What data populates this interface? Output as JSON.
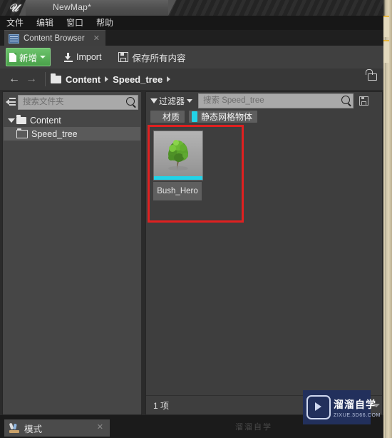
{
  "window": {
    "logo_icon": "unreal-engine-logo",
    "map_tab_title": "NewMap*"
  },
  "menubar": {
    "items": [
      {
        "label": "文件"
      },
      {
        "label": "编辑"
      },
      {
        "label": "窗口"
      },
      {
        "label": "帮助"
      }
    ]
  },
  "content_browser": {
    "tab": {
      "icon": "content-browser-icon",
      "label": "Content Browser",
      "close_label": "✕"
    },
    "toolbar": {
      "new_label": "新增",
      "import_label": "Import",
      "save_all_label": "保存所有内容"
    },
    "breadcrumb": {
      "back_label": "←",
      "forward_label": "→",
      "separator": "",
      "items": [
        {
          "label": "Content"
        },
        {
          "label": "Speed_tree"
        }
      ],
      "lock_icon": "unlock-icon"
    },
    "folder_panel": {
      "search_placeholder": "搜索文件夹",
      "search_value": "",
      "tree": [
        {
          "label": "Content",
          "expanded": true,
          "selected": false
        },
        {
          "label": "Speed_tree",
          "expanded": false,
          "selected": true
        }
      ]
    },
    "asset_panel": {
      "filter_button_label": "过滤器",
      "search_placeholder": "搜索 Speed_tree",
      "search_value": "",
      "save_search_icon": "save-search-icon",
      "filter_chips": [
        {
          "label": "材质",
          "color": "#5e5e5e",
          "swatch": "#5e5e5e"
        },
        {
          "label": "静态网格物体",
          "color": "#5e5e5e",
          "swatch": "#22d3e8"
        }
      ],
      "assets": [
        {
          "name": "Bush_Hero",
          "type": "static-mesh",
          "accent": "#22d3e8"
        }
      ],
      "status_count": "1 项",
      "annotation": {
        "color": "#e02020",
        "shape": "rectangle"
      }
    }
  },
  "modes_bar": {
    "tab_label": "模式",
    "tab_icon": "modes-icon",
    "close_label": "✕"
  },
  "watermark": {
    "title": "溜溜自学",
    "subtitle": "ZIXUE.3D66.COM",
    "icon": "play-logo-icon",
    "bg_color": "#22305c",
    "ghost_text": "溜溜自学"
  }
}
